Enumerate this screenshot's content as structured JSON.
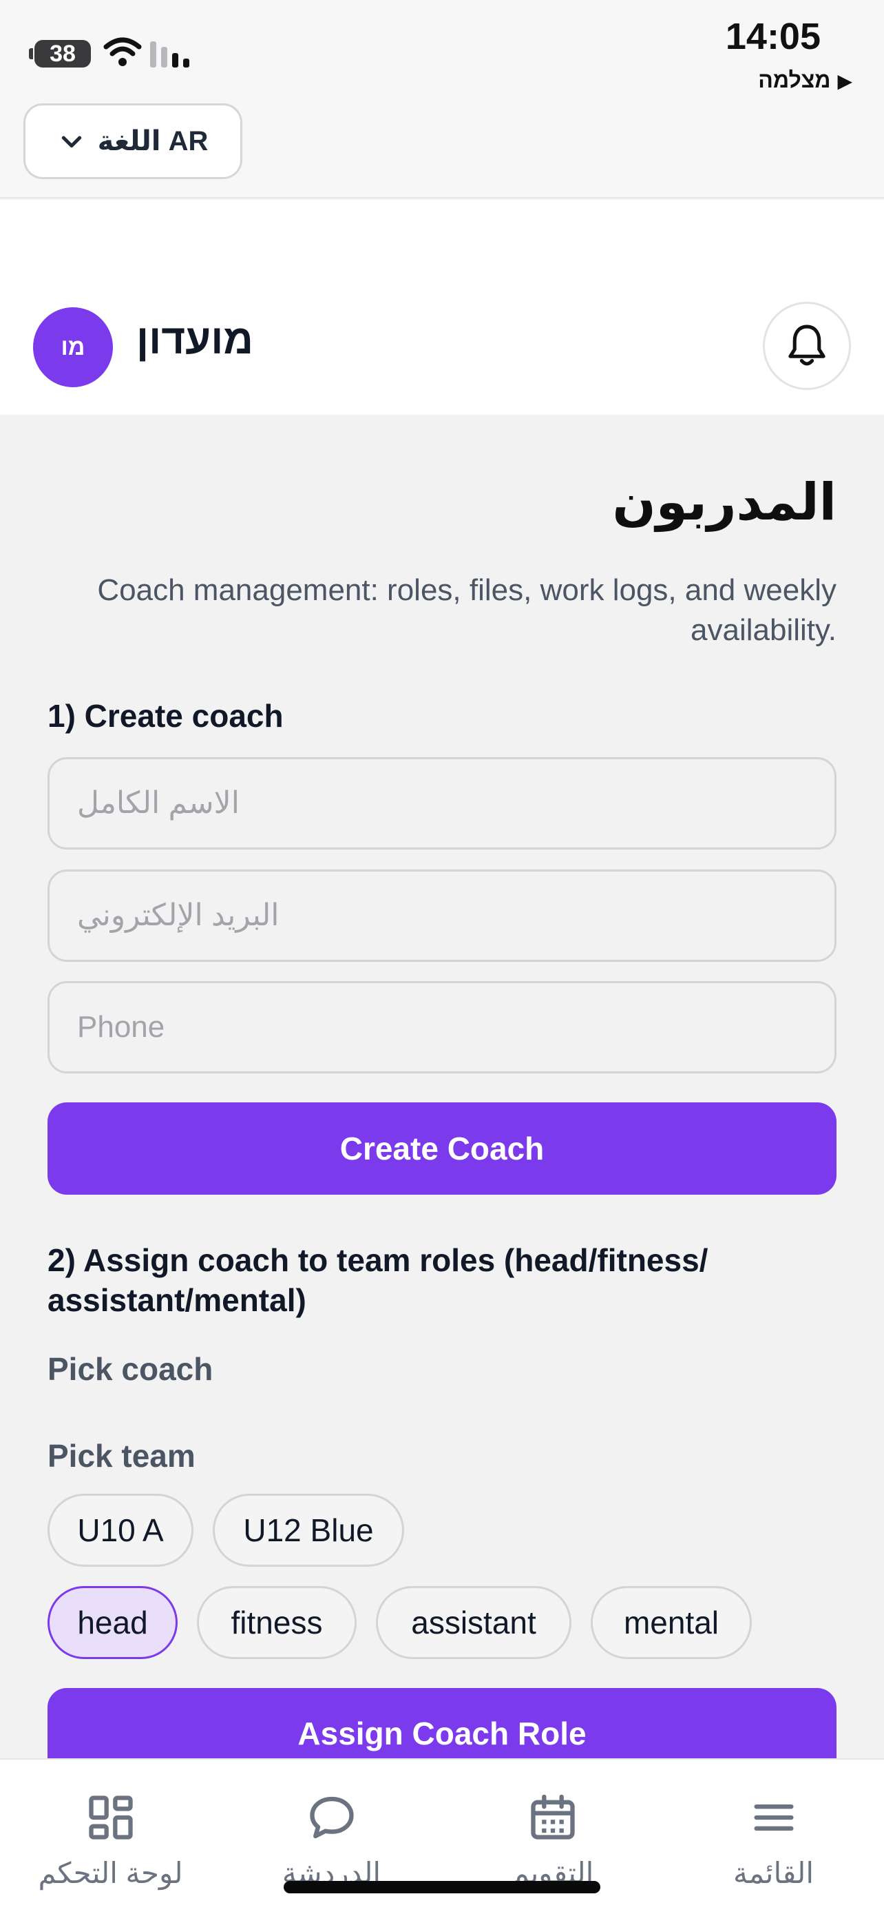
{
  "status_bar": {
    "battery": "38",
    "time": "14:05",
    "carrier_label": "מצלמה",
    "icons": [
      "battery-icon",
      "wifi-icon",
      "signal-icon",
      "play-triangle-icon"
    ]
  },
  "language": {
    "label": "اللغة AR",
    "icon": "chevron-down-icon"
  },
  "header": {
    "avatar_initials": "מו",
    "club_name": "מועדון",
    "icon": "bell-icon"
  },
  "page": {
    "title": "المدربون",
    "description": "Coach management: roles, files, work logs, and weekly availability."
  },
  "create_coach": {
    "title": "1) Create coach",
    "fullname_placeholder": "الاسم الكامل",
    "email_placeholder": "البريد الإلكتروني",
    "phone_placeholder": "Phone",
    "button_label": "Create Coach"
  },
  "assign_role": {
    "title": "2) Assign coach to team roles (head/fitness/ assistant/mental)",
    "pick_coach_label": "Pick coach",
    "pick_team_label": "Pick team",
    "teams": [
      "U10 A",
      "U12 Blue"
    ],
    "roles": [
      "head",
      "fitness",
      "assistant",
      "mental"
    ],
    "selected_role": "head",
    "button_label": "Assign Coach Role"
  },
  "bottom_nav": [
    {
      "label": "لوحة التحكم",
      "icon": "dashboard-icon"
    },
    {
      "label": "الدردشة",
      "icon": "chat-icon"
    },
    {
      "label": "التقويم",
      "icon": "calendar-icon"
    },
    {
      "label": "القائمة",
      "icon": "menu-icon"
    }
  ],
  "colors": {
    "accent": "#7c3aed",
    "background": "#f2f2f3",
    "selected_chip": "#e9dffb"
  }
}
